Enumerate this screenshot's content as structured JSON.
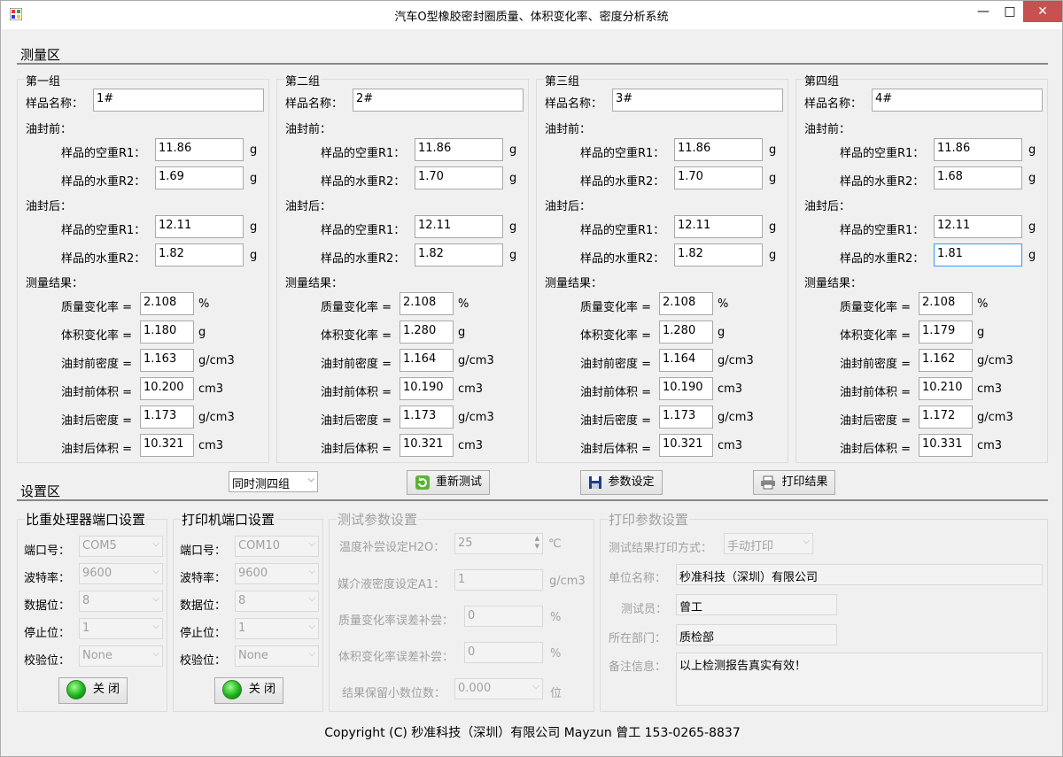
{
  "window": {
    "title": "汽车O型橡胶密封圈质量、体积变化率、密度分析系统",
    "min": "—",
    "max": "□",
    "close": "✕"
  },
  "measure_area": {
    "title": "测量区"
  },
  "labels": {
    "sample_name": "样品名称：",
    "before": "油封前：",
    "after": "油封后：",
    "r1": "样品的空重R1：",
    "r2": "样品的水重R2：",
    "unit_g": "g",
    "results": "测量结果：",
    "mass_rate": "质量变化率 =",
    "vol_rate": "体积变化率 =",
    "den_before": "油封前密度 =",
    "vol_before": "油封前体积 =",
    "den_after": "油封后密度 =",
    "vol_after": "油封后体积 =",
    "unit_pct": "%",
    "unit_gcm3": "g/cm3",
    "unit_cm3": "cm3"
  },
  "groups": [
    {
      "title": "第一组",
      "name": "1#",
      "before_r1": "11.86",
      "before_r2": "1.69",
      "after_r1": "12.11",
      "after_r2": "1.82",
      "mass_rate": "2.108",
      "vol_rate": "1.180",
      "den_before": "1.163",
      "vol_before": "10.200",
      "den_after": "1.173",
      "vol_after": "10.321"
    },
    {
      "title": "第二组",
      "name": "2#",
      "before_r1": "11.86",
      "before_r2": "1.70",
      "after_r1": "12.11",
      "after_r2": "1.82",
      "mass_rate": "2.108",
      "vol_rate": "1.280",
      "den_before": "1.164",
      "vol_before": "10.190",
      "den_after": "1.173",
      "vol_after": "10.321"
    },
    {
      "title": "第三组",
      "name": "3#",
      "before_r1": "11.86",
      "before_r2": "1.70",
      "after_r1": "12.11",
      "after_r2": "1.82",
      "mass_rate": "2.108",
      "vol_rate": "1.280",
      "den_before": "1.164",
      "vol_before": "10.190",
      "den_after": "1.173",
      "vol_after": "10.321"
    },
    {
      "title": "第四组",
      "name": "4#",
      "before_r1": "11.86",
      "before_r2": "1.68",
      "after_r1": "12.11",
      "after_r2": "1.81",
      "mass_rate": "2.108",
      "vol_rate": "1.179",
      "den_before": "1.162",
      "vol_before": "10.210",
      "den_after": "1.172",
      "vol_after": "10.331"
    }
  ],
  "toolbar": {
    "mode_select": "同时测四组",
    "retest": "重新测试",
    "params": "参数设定",
    "print": "打印结果"
  },
  "settings_area": {
    "title": "设置区"
  },
  "port_labels": {
    "port": "端口号：",
    "baud": "波特率：",
    "data": "数据位：",
    "stop": "停止位：",
    "parity": "校验位："
  },
  "scale_port": {
    "title": "比重处理器端口设置",
    "port": "COM5",
    "baud": "9600",
    "data": "8",
    "stop": "1",
    "parity": "None",
    "button": "关 闭"
  },
  "printer_port": {
    "title": "打印机端口设置",
    "port": "COM10",
    "baud": "9600",
    "data": "8",
    "stop": "1",
    "parity": "None",
    "button": "关 闭"
  },
  "test_params": {
    "title": "测试参数设置",
    "temp_label": "温度补尝设定H2O：",
    "temp_value": "25",
    "temp_unit": "℃",
    "density_label": "媒介液密度设定A1：",
    "density_value": "1",
    "density_unit": "g/cm3",
    "mass_comp_label": "质量变化率误差补尝：",
    "mass_comp_value": "0",
    "mass_comp_unit": "%",
    "vol_comp_label": "体积变化率误差补尝：",
    "vol_comp_value": "0",
    "vol_comp_unit": "%",
    "decimals_label": "结果保留小数位数：",
    "decimals_value": "0.000",
    "decimals_unit": "位"
  },
  "print_params": {
    "title": "打印参数设置",
    "mode_label": "测试结果打印方式：",
    "mode_value": "手动打印",
    "company_label": "单位名称：",
    "company_value": "秒准科技（深圳）有限公司",
    "tester_label": "测试员：",
    "tester_value": "曾工",
    "dept_label": "所在部门：",
    "dept_value": "质检部",
    "remark_label": "备注信息：",
    "remark_value": "以上检测报告真实有效！"
  },
  "footer": {
    "copyright": "Copyright (C) 秒准科技（深圳）有限公司 Mayzun 曾工 153-0265-8837"
  }
}
